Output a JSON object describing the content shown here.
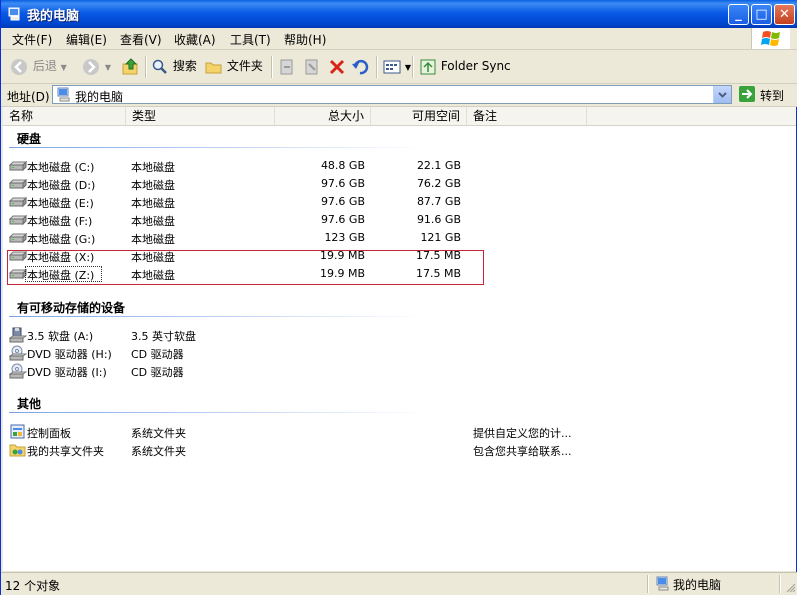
{
  "window": {
    "title": "我的电脑"
  },
  "menu": [
    "文件(F)",
    "编辑(E)",
    "查看(V)",
    "收藏(A)",
    "工具(T)",
    "帮助(H)"
  ],
  "toolbar": {
    "back": "后退",
    "search": "搜索",
    "folders": "文件夹",
    "folder_sync": "Folder Sync"
  },
  "address": {
    "label": "地址(D)",
    "value": "我的电脑",
    "go": "转到"
  },
  "columns": [
    "名称",
    "类型",
    "总大小",
    "可用空间",
    "备注"
  ],
  "groups": [
    {
      "title": "硬盘",
      "items": [
        {
          "name": "本地磁盘 (C:)",
          "type": "本地磁盘",
          "total": "48.8 GB",
          "free": "22.1 GB",
          "note": "",
          "icon": "hard-drive-icon"
        },
        {
          "name": "本地磁盘 (D:)",
          "type": "本地磁盘",
          "total": "97.6 GB",
          "free": "76.2 GB",
          "note": "",
          "icon": "hard-drive-icon"
        },
        {
          "name": "本地磁盘 (E:)",
          "type": "本地磁盘",
          "total": "97.6 GB",
          "free": "87.7 GB",
          "note": "",
          "icon": "hard-drive-icon"
        },
        {
          "name": "本地磁盘 (F:)",
          "type": "本地磁盘",
          "total": "97.6 GB",
          "free": "91.6 GB",
          "note": "",
          "icon": "hard-drive-icon"
        },
        {
          "name": "本地磁盘 (G:)",
          "type": "本地磁盘",
          "total": "123 GB",
          "free": "121 GB",
          "note": "",
          "icon": "hard-drive-icon"
        },
        {
          "name": "本地磁盘 (X:)",
          "type": "本地磁盘",
          "total": "19.9 MB",
          "free": "17.5 MB",
          "note": "",
          "icon": "hard-drive-icon"
        },
        {
          "name": "本地磁盘 (Z:)",
          "type": "本地磁盘",
          "total": "19.9 MB",
          "free": "17.5 MB",
          "note": "",
          "icon": "hard-drive-icon"
        }
      ]
    },
    {
      "title": "有可移动存储的设备",
      "items": [
        {
          "name": "3.5 软盘 (A:)",
          "type": "3.5 英寸软盘",
          "total": "",
          "free": "",
          "note": "",
          "icon": "floppy-drive-icon"
        },
        {
          "name": "DVD 驱动器 (H:)",
          "type": "CD 驱动器",
          "total": "",
          "free": "",
          "note": "",
          "icon": "dvd-drive-icon"
        },
        {
          "name": "DVD 驱动器 (I:)",
          "type": "CD 驱动器",
          "total": "",
          "free": "",
          "note": "",
          "icon": "dvd-drive-icon"
        }
      ]
    },
    {
      "title": "其他",
      "items": [
        {
          "name": "控制面板",
          "type": "系统文件夹",
          "total": "",
          "free": "",
          "note": "提供自定义您的计...",
          "icon": "control-panel-icon"
        },
        {
          "name": "我的共享文件夹",
          "type": "系统文件夹",
          "total": "",
          "free": "",
          "note": "包含您共享给联系...",
          "icon": "shared-folder-icon"
        }
      ]
    }
  ],
  "status": {
    "count": "12 个对象",
    "location": "我的电脑"
  },
  "colors": {
    "titlebar": "#0a5ae6",
    "highlight_border": "#c32636",
    "group_line": "#7ba2e7"
  }
}
